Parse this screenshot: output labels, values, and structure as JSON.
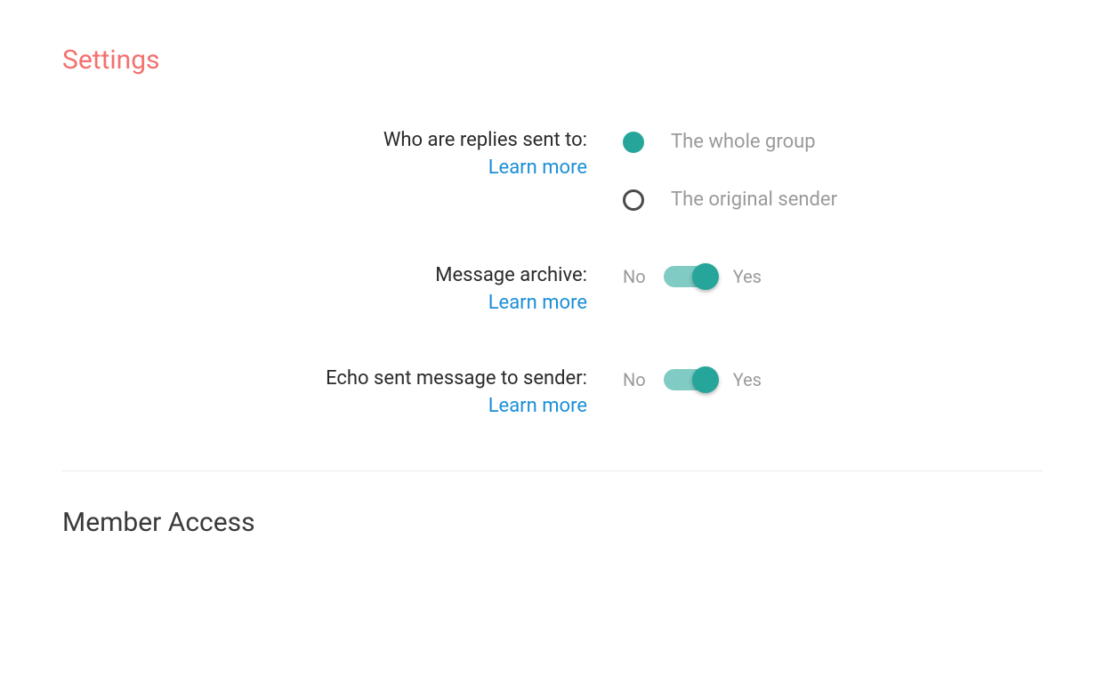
{
  "sections": {
    "settings": {
      "title": "Settings",
      "items": {
        "replies": {
          "label": "Who are replies sent to:",
          "learn_more": "Learn more",
          "options": [
            {
              "label": "The whole group",
              "selected": true
            },
            {
              "label": "The original sender",
              "selected": false
            }
          ]
        },
        "archive": {
          "label": "Message archive:",
          "learn_more": "Learn more",
          "no_label": "No",
          "yes_label": "Yes",
          "value": true
        },
        "echo": {
          "label": "Echo sent message to sender:",
          "learn_more": "Learn more",
          "no_label": "No",
          "yes_label": "Yes",
          "value": true
        }
      }
    },
    "member_access": {
      "title": "Member Access"
    }
  }
}
